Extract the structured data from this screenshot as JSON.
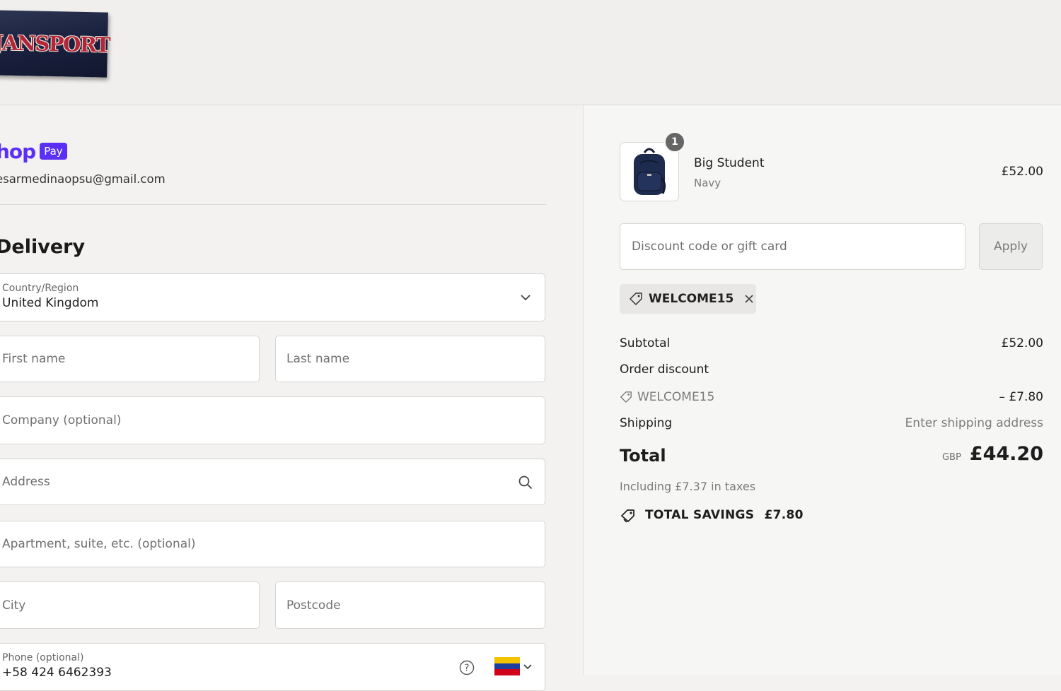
{
  "brand": {
    "logo_text": "JANSPORT"
  },
  "shop_pay": {
    "word": "hop",
    "badge": "Pay"
  },
  "account": {
    "email": "esarmedinaopsu@gmail.com"
  },
  "delivery": {
    "title": "Delivery",
    "country": {
      "label": "Country/Region",
      "value": "United Kingdom"
    },
    "first_name": {
      "placeholder": "First name"
    },
    "last_name": {
      "placeholder": "Last name"
    },
    "company": {
      "placeholder": "Company (optional)"
    },
    "address": {
      "placeholder": "Address"
    },
    "apartment": {
      "placeholder": "Apartment, suite, etc. (optional)"
    },
    "city": {
      "placeholder": "City"
    },
    "postcode": {
      "placeholder": "Postcode"
    },
    "phone": {
      "label": "Phone (optional)",
      "value": "+58 424 6462393"
    }
  },
  "summary": {
    "item": {
      "name": "Big Student",
      "variant": "Navy",
      "price": "£52.00",
      "quantity": "1"
    },
    "discount": {
      "placeholder": "Discount code or gift card",
      "apply_label": "Apply",
      "applied_code": "WELCOME15"
    },
    "subtotal": {
      "label": "Subtotal",
      "value": "£52.00"
    },
    "order_discount": {
      "label": "Order discount",
      "code": "WELCOME15",
      "value": "– £7.80"
    },
    "shipping": {
      "label": "Shipping",
      "value": "Enter shipping address"
    },
    "total": {
      "label": "Total",
      "currency": "GBP",
      "value": "£44.20"
    },
    "taxes_note": "Including £7.37 in taxes",
    "savings": {
      "label": "TOTAL SAVINGS",
      "value": "£7.80"
    }
  },
  "colors": {
    "shop_pay_purple": "#5a31f4",
    "logo_navy": "#1b2240",
    "logo_red": "#b3263a",
    "flag_colors": [
      "#f4c300",
      "#1f3d9c",
      "#d0021b"
    ]
  },
  "icons": [
    "chevron-down-icon",
    "search-icon",
    "help-icon",
    "tag-icon",
    "close-icon",
    "backpack-image",
    "venezuela-flag-icon"
  ]
}
